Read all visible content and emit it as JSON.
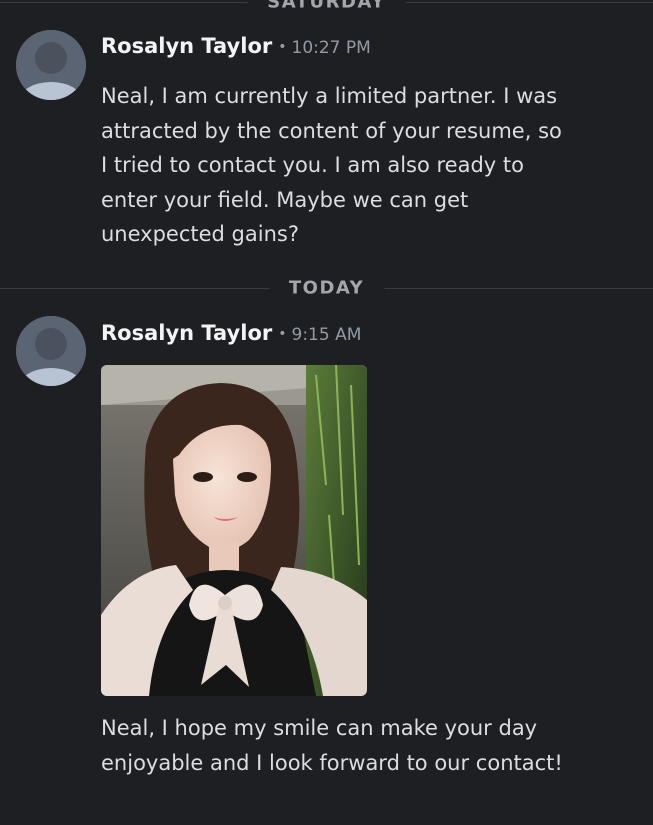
{
  "dividers": {
    "saturday": "SATURDAY",
    "today": "TODAY"
  },
  "messages": [
    {
      "author": "Rosalyn Taylor",
      "separator": "•",
      "time": "10:27 PM",
      "text": "Neal, I am currently a limited partner. I was attracted by the content of your resume, so I tried to contact you. I am also ready to enter your field. Maybe we can get unexpected gains?"
    },
    {
      "author": "Rosalyn Taylor",
      "separator": "•",
      "time": "9:15 AM",
      "attachment": "photo",
      "text": "Neal, I hope my smile can make your day enjoyable and I look forward to our contact!"
    }
  ],
  "colors": {
    "background": "#1e1f22",
    "author": "#f2f3f5",
    "text": "#dbdee1",
    "muted": "#949ba4",
    "divider": "#3a3c42",
    "avatar_bg": "#5b6472",
    "avatar_fg": "#b8c4d3"
  },
  "icons": {
    "avatar": "default-user-avatar-icon"
  }
}
